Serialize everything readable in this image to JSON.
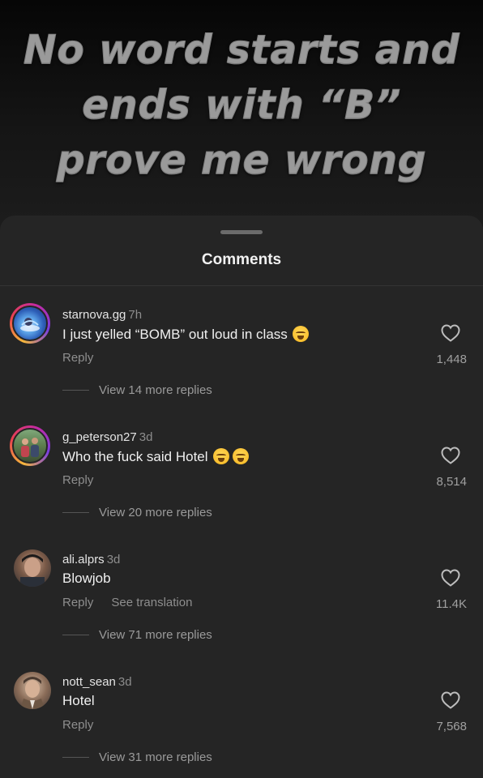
{
  "hero": {
    "caption": "No word starts and ends with “B” prove me wrong"
  },
  "sheet": {
    "title": "Comments"
  },
  "comments": [
    {
      "username": "starnova.gg",
      "time": "7h",
      "text": "I just yelled “BOMB” out loud in class",
      "reply_label": "Reply",
      "likes": "1,448",
      "view_replies": "View 14 more replies",
      "avatar_icon": "avatar-icon"
    },
    {
      "username": "g_peterson27",
      "time": "3d",
      "text": "Who the fuck said Hotel",
      "reply_label": "Reply",
      "likes": "8,514",
      "view_replies": "View 20 more replies",
      "avatar_icon": "avatar-icon"
    },
    {
      "username": "ali.alprs",
      "time": "3d",
      "text": "Blowjob",
      "reply_label": "Reply",
      "translation_label": "See translation",
      "likes": "11.4K",
      "view_replies": "View 71 more replies",
      "avatar_icon": "avatar-icon"
    },
    {
      "username": "nott_sean",
      "time": "3d",
      "text": "Hotel",
      "reply_label": "Reply",
      "likes": "7,568",
      "view_replies": "View 31 more replies",
      "avatar_icon": "avatar-icon"
    }
  ],
  "icons": {
    "like": "heart-outline-icon",
    "emoji": "loudly-crying-face-emoji"
  },
  "colors": {
    "sheet_bg": "#252525",
    "page_bg": "#141414",
    "muted_text": "#8e8e8e",
    "story_ring": "#e9414f"
  }
}
